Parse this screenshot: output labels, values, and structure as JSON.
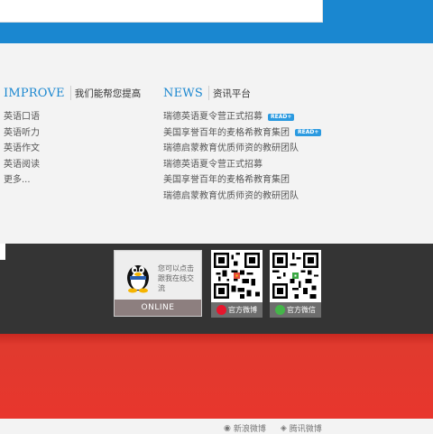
{
  "improve": {
    "title_en": "IMPROVE",
    "title_cn": "我们能帮您提高",
    "items": [
      "英语口语",
      "英语听力",
      "英语作文",
      "英语阅读",
      "更多..."
    ]
  },
  "news": {
    "title_en": "NEWS",
    "title_cn": "资讯平台",
    "items": [
      {
        "text": "瑞德英语夏令营正式招募",
        "badge": "READ+"
      },
      {
        "text": "美国享誉百年的麦格希教育集团",
        "badge": "READ+"
      },
      {
        "text": "瑞德启蒙教育优质师资的教研团队",
        "badge": ""
      },
      {
        "text": "瑞德英语夏令营正式招募",
        "badge": ""
      },
      {
        "text": "美国享誉百年的麦格希教育集团",
        "badge": ""
      },
      {
        "text": "瑞德启蒙教育优质师资的教研团队",
        "badge": ""
      }
    ]
  },
  "qq": {
    "text": "您可以点击跟我在线交流",
    "status": "ONLINE"
  },
  "weibo": {
    "label": "官方微博"
  },
  "wechat": {
    "label": "官方微信"
  },
  "bottom": {
    "weibo": "新浪微博",
    "tencent": "腾讯微博"
  },
  "colors": {
    "blue": "#1a87d0",
    "dark": "#343434",
    "red": "#e8362d"
  }
}
